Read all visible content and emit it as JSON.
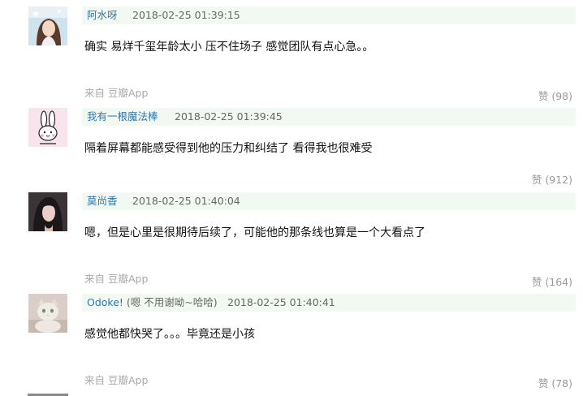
{
  "comments": [
    {
      "author": "阿水呀",
      "author_note": "",
      "time": "2018-02-25 01:39:15",
      "text": "确实 易烊千玺年龄太小 压不住场子 感觉团队有点心急。。",
      "source": "来自 豆瓣App",
      "vote": "赞 (98)"
    },
    {
      "author": "我有一根魔法棒",
      "author_note": "",
      "time": "2018-02-25 01:39:45",
      "text": "隔着屏幕都能感受得到他的压力和纠结了 看得我也很难受",
      "source": "",
      "vote": "赞 (912)"
    },
    {
      "author": "莫尚香",
      "author_note": "",
      "time": "2018-02-25 01:40:04",
      "text": "嗯，但是心里是很期待后续了，可能他的那条线也算是一个大看点了",
      "source": "来自 豆瓣App",
      "vote": "赞 (164)"
    },
    {
      "author": "Odoke!",
      "author_note": "(嗯 不用谢呦~哈哈)",
      "time": "2018-02-25 01:40:41",
      "text": "感觉他都快哭了。。。毕竟还是小孩",
      "source": "来自 豆瓣App",
      "vote": "赞 (78)"
    }
  ],
  "colors": {
    "author_link": "#3377aa",
    "header_bg": "#f2f8f2",
    "meta_gray": "#666666",
    "source_gray": "#aaaaaa",
    "vote_gray": "#999999"
  }
}
